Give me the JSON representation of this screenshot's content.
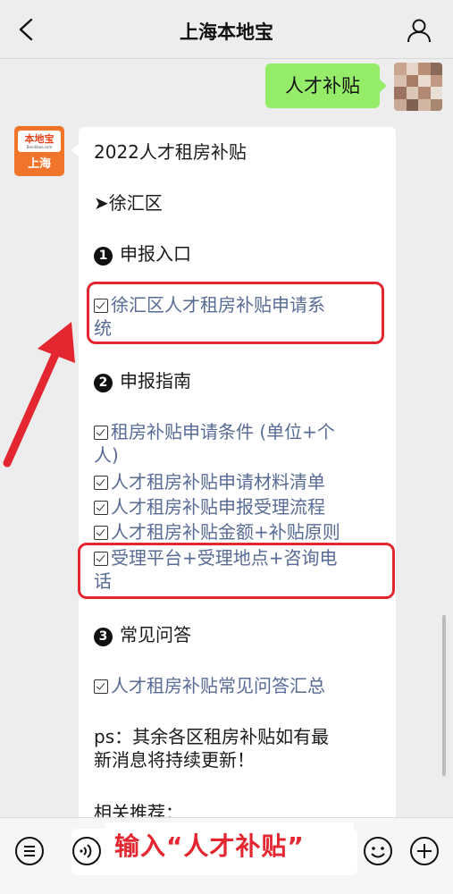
{
  "header": {
    "title": "上海本地宝"
  },
  "sent_message": {
    "text": "人才补贴"
  },
  "bot": {
    "logo_name": "本地宝",
    "logo_url": "Bendibao.com",
    "logo_city": "上海"
  },
  "reply": {
    "line_title": "2022人才租房补贴",
    "line_district": "➤徐汇区",
    "section1": {
      "num": "1",
      "label": "申报入口"
    },
    "link1_l1": "徐汇区人才租房补贴申请系",
    "link1_l2": "统",
    "section2": {
      "num": "2",
      "label": "申报指南"
    },
    "guide": [
      {
        "l1": "租房补贴申请条件 (单位+个",
        "l2": "人)"
      },
      {
        "l1": "人才租房补贴申请材料清单"
      },
      {
        "l1": "人才租房补贴申报受理流程"
      },
      {
        "l1": "人才租房补贴金额+补贴原则"
      },
      {
        "l1": "受理平台+受理地点+咨询电",
        "l2": "话"
      }
    ],
    "section3": {
      "num": "3",
      "label": "常见问答"
    },
    "faq_link": "人才租房补贴常见问答汇总",
    "ps_l1": "ps：其余各区租房补贴如有最",
    "ps_l2": "新消息将持续更新！",
    "related": "相关推荐："
  },
  "input": {
    "annotation": "输入“人才补贴”"
  },
  "colors": {
    "highlight": "#e3262f",
    "link": "#576b95",
    "sent_bubble": "#95ec69"
  }
}
